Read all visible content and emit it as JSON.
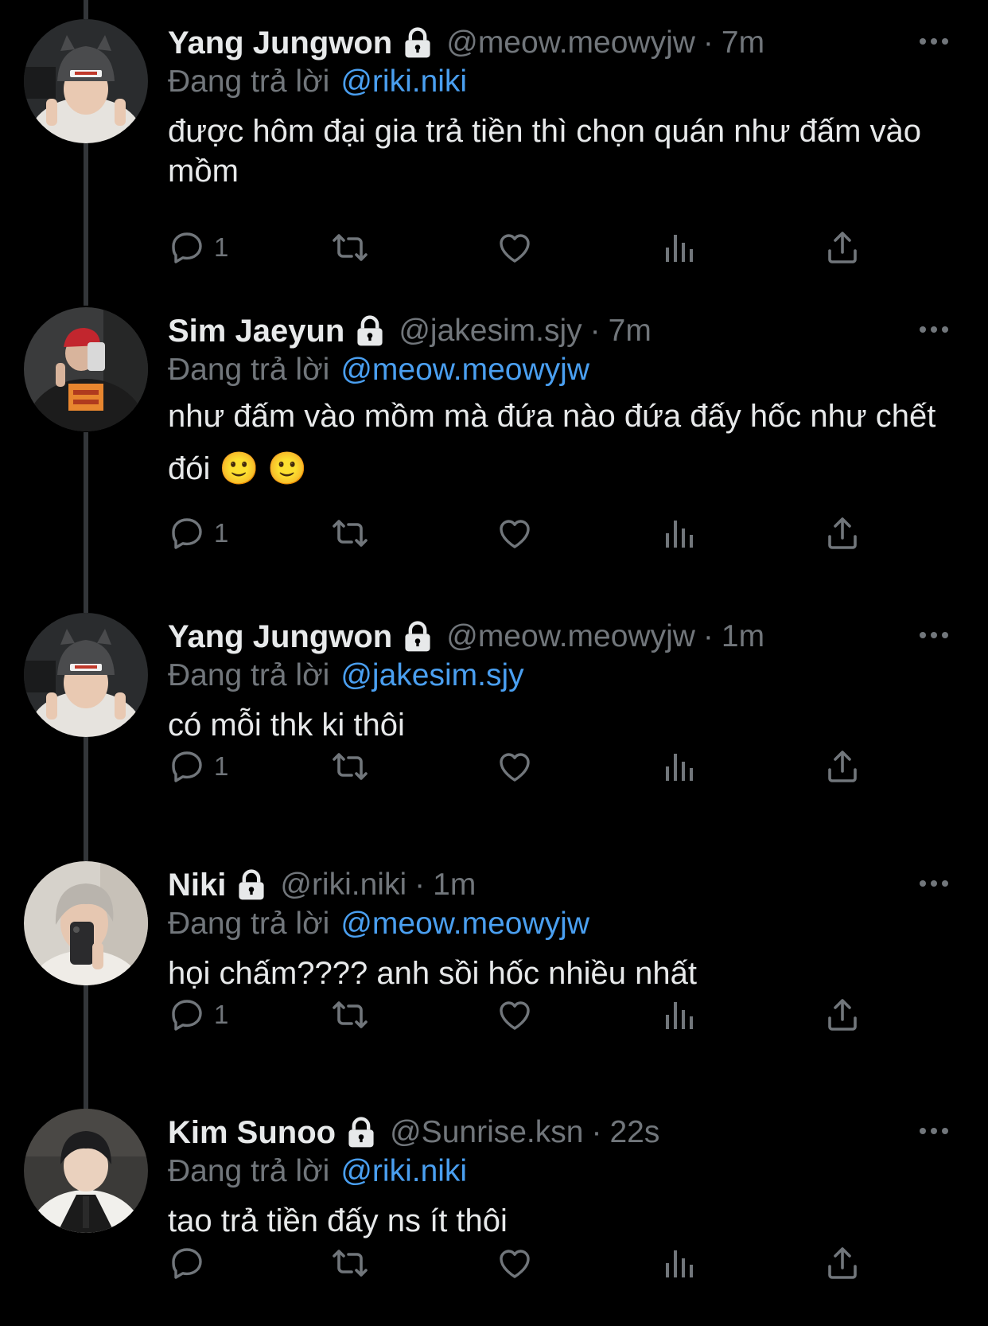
{
  "colors": {
    "background": "#000000",
    "primary_text": "#e7e9ea",
    "secondary_text": "#71767b",
    "link": "#4a9ff0",
    "thread_line": "#333639"
  },
  "reply_prefix": "Đang trả lời",
  "icons": {
    "lock": "lock-icon",
    "more": "more-icon",
    "reply": "reply-icon",
    "retweet": "retweet-icon",
    "like": "heart-icon",
    "views": "views-icon",
    "share": "share-icon"
  },
  "tweets": [
    {
      "name": "Yang Jungwon",
      "handle": "@meow.meowyjw",
      "dot": "·",
      "time": "7m",
      "reply_to": "@riki.niki",
      "text": "được hôm đại gia trả tiền thì chọn quán như đấm vào mồm",
      "reply_count": "1"
    },
    {
      "name": "Sim Jaeyun",
      "handle": "@jakesim.sjy",
      "dot": "·",
      "time": "7m",
      "reply_to": "@meow.meowyjw",
      "text": "như đấm vào mồm mà đứa nào đứa đấy hốc như chết đói 🙂 🙂",
      "reply_count": "1"
    },
    {
      "name": "Yang Jungwon",
      "handle": "@meow.meowyjw",
      "dot": "·",
      "time": "1m",
      "reply_to": "@jakesim.sjy",
      "text": "có mỗi thk ki thôi",
      "reply_count": "1"
    },
    {
      "name": "Niki",
      "handle": "@riki.niki",
      "dot": "·",
      "time": "1m",
      "reply_to": "@meow.meowyjw",
      "text": "họi chấm???? anh sồi hốc nhiều nhất",
      "reply_count": "1"
    },
    {
      "name": "Kim Sunoo",
      "handle": "@Sunrise.ksn",
      "dot": "·",
      "time": "22s",
      "reply_to": "@riki.niki",
      "text": "tao trả tiền đấy ns ít thôi",
      "reply_count": ""
    }
  ]
}
